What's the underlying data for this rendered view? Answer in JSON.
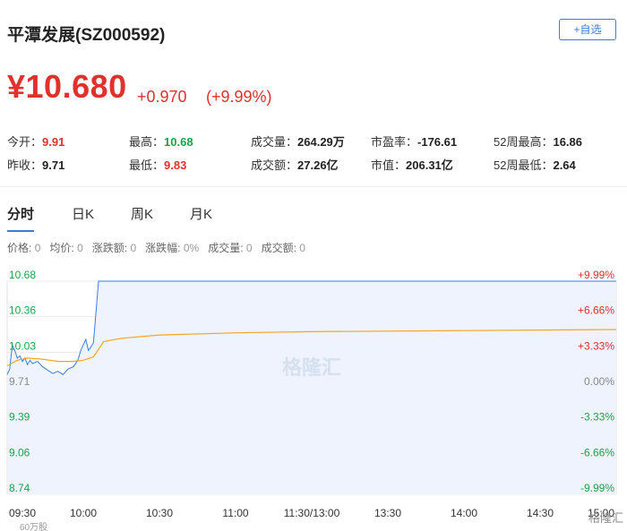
{
  "header": {
    "stock_name": "平潭发展(SZ000592)",
    "watch_button": "+自选"
  },
  "quote": {
    "price": "¥10.680",
    "change": "+0.970",
    "change_pct": "(+9.99%)"
  },
  "stats": {
    "open_label": "今开：",
    "open_value": "9.91",
    "prev_close_label": "昨收：",
    "prev_close_value": "9.71",
    "high_label": "最高：",
    "high_value": "10.68",
    "low_label": "最低：",
    "low_value": "9.83",
    "volume_label": "成交量：",
    "volume_value": "264.29万",
    "amount_label": "成交额：",
    "amount_value": "27.26亿",
    "pe_label": "市盈率：",
    "pe_value": "-176.61",
    "mktcap_label": "市值：",
    "mktcap_value": "206.31亿",
    "high52_label": "52周最高：",
    "high52_value": "16.86",
    "low52_label": "52周最低：",
    "low52_value": "2.64"
  },
  "tabs": [
    {
      "label": "分时",
      "active": true
    },
    {
      "label": "日K",
      "active": false
    },
    {
      "label": "周K",
      "active": false
    },
    {
      "label": "月K",
      "active": false
    }
  ],
  "crosshair_info": {
    "price_label": "价格:",
    "price_value": "0",
    "avg_label": "均价:",
    "avg_value": "0",
    "chg_label": "涨跌额:",
    "chg_value": "0",
    "chgpct_label": "涨跌幅:",
    "chgpct_value": "0%",
    "vol_label": "成交量:",
    "vol_value": "0",
    "amt_label": "成交额:",
    "amt_value": "0"
  },
  "watermark": "格隆汇",
  "corner_logo": "格隆汇",
  "volume_axis_label": "60万股",
  "colors": {
    "up": "#e0312d",
    "down": "#1aa34a",
    "price_line": "#3b7ddd",
    "avg_line": "#f5a623",
    "fill": "#eef3fd"
  },
  "chart_data": {
    "type": "line",
    "y_left_ticks": [
      "10.68",
      "10.36",
      "10.03",
      "9.71",
      "9.39",
      "9.06",
      "8.74"
    ],
    "y_right_ticks": [
      "+9.99%",
      "+6.66%",
      "+3.33%",
      "0.00%",
      "-3.33%",
      "-6.66%",
      "-9.99%"
    ],
    "x_ticks": [
      "09:30",
      "10:00",
      "10:30",
      "11:00",
      "11:30/13:00",
      "13:30",
      "14:00",
      "14:30",
      "15:00"
    ],
    "ylim": [
      8.74,
      10.68
    ],
    "x_range_minutes": [
      0,
      240
    ],
    "series": [
      {
        "x": [
          0,
          1,
          2,
          3,
          4,
          5,
          6,
          7,
          8,
          9,
          10,
          12,
          14,
          16,
          18,
          20,
          22,
          24,
          26,
          27,
          28,
          29,
          30,
          31,
          32,
          33,
          34,
          35,
          36,
          37,
          38,
          240
        ],
        "y": [
          9.83,
          9.88,
          10.1,
          10.05,
          9.98,
          10.0,
          9.95,
          9.98,
          9.92,
          9.96,
          9.93,
          9.95,
          9.9,
          9.87,
          9.84,
          9.86,
          9.83,
          9.88,
          9.9,
          9.93,
          9.97,
          10.05,
          10.1,
          10.15,
          10.05,
          10.08,
          10.12,
          10.4,
          10.68,
          10.68,
          10.68,
          10.68
        ]
      },
      {
        "x": [
          0,
          4,
          8,
          14,
          20,
          26,
          30,
          34,
          36,
          38,
          45,
          60,
          90,
          120,
          180,
          240
        ],
        "y": [
          9.91,
          9.96,
          9.98,
          9.97,
          9.95,
          9.95,
          9.96,
          9.99,
          10.06,
          10.13,
          10.16,
          10.19,
          10.21,
          10.22,
          10.23,
          10.24
        ]
      }
    ]
  }
}
